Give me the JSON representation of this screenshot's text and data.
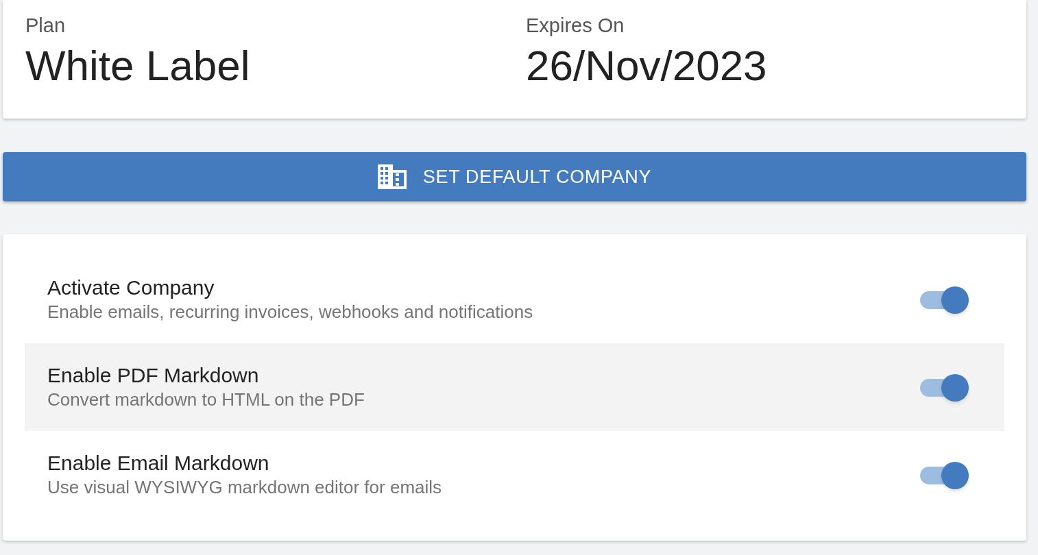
{
  "plan_card": {
    "fields": [
      {
        "label": "Plan",
        "value": "White Label"
      },
      {
        "label": "Expires On",
        "value": "26/Nov/2023"
      }
    ]
  },
  "default_button": {
    "label": "SET DEFAULT COMPANY"
  },
  "settings": [
    {
      "title": "Activate Company",
      "description": "Enable emails, recurring invoices, webhooks and notifications",
      "on": true,
      "hovered": false
    },
    {
      "title": "Enable PDF Markdown",
      "description": "Convert markdown to HTML on the PDF",
      "on": true,
      "hovered": true
    },
    {
      "title": "Enable Email Markdown",
      "description": "Use visual WYSIWYG markdown editor for emails",
      "on": true,
      "hovered": false
    }
  ]
}
